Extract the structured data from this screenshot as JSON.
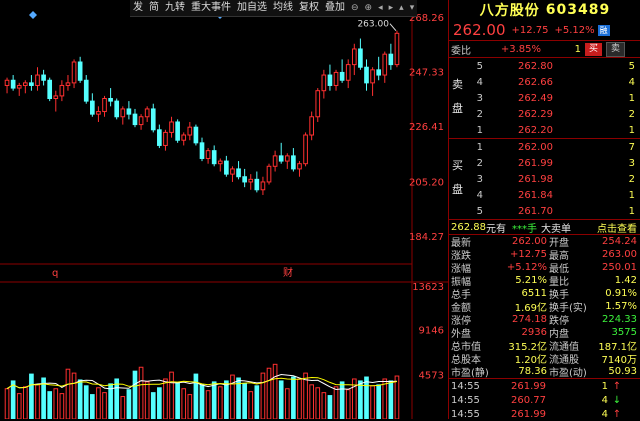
{
  "toolbar": {
    "items": [
      "发",
      "简",
      "九转",
      "重大事件",
      "加自选",
      "均线",
      "复权",
      "叠加"
    ],
    "controls": [
      "⊖",
      "⊕",
      "◂",
      "▸",
      "▴",
      "▾"
    ]
  },
  "chart": {
    "y_labels": [
      "268.26",
      "247.33",
      "226.41",
      "205.20",
      "184.27"
    ],
    "high_label": "263.00",
    "markers": [
      "q",
      "财"
    ],
    "vol_labels": [
      "13623",
      "9146",
      "4573"
    ],
    "colors": {
      "up": "#ff3030",
      "down": "#55ffff",
      "ma1": "#ffffff",
      "ma2": "#ffff00",
      "grid": "#8b0000"
    }
  },
  "chart_data": {
    "type": "candlestick",
    "price_candles": [
      [
        242,
        245,
        239,
        244
      ],
      [
        244,
        246,
        240,
        241
      ],
      [
        241,
        243,
        238,
        242
      ],
      [
        242,
        244,
        239,
        243
      ],
      [
        243,
        246,
        240,
        242
      ],
      [
        242,
        249,
        240,
        246
      ],
      [
        246,
        248,
        242,
        244
      ],
      [
        244,
        245,
        236,
        237
      ],
      [
        237,
        240,
        232,
        238
      ],
      [
        238,
        244,
        236,
        242
      ],
      [
        242,
        246,
        240,
        243
      ],
      [
        243,
        252,
        241,
        251
      ],
      [
        251,
        253,
        243,
        244
      ],
      [
        244,
        246,
        235,
        236
      ],
      [
        236,
        239,
        230,
        231
      ],
      [
        231,
        234,
        228,
        232
      ],
      [
        232,
        238,
        230,
        237
      ],
      [
        237,
        241,
        234,
        236
      ],
      [
        236,
        237,
        229,
        230
      ],
      [
        230,
        234,
        227,
        233
      ],
      [
        233,
        236,
        229,
        231
      ],
      [
        231,
        233,
        226,
        227
      ],
      [
        227,
        231,
        225,
        230
      ],
      [
        230,
        234,
        228,
        233
      ],
      [
        233,
        235,
        224,
        225
      ],
      [
        225,
        227,
        218,
        219
      ],
      [
        219,
        225,
        217,
        224
      ],
      [
        224,
        230,
        222,
        228
      ],
      [
        228,
        229,
        220,
        221
      ],
      [
        221,
        224,
        219,
        223
      ],
      [
        223,
        228,
        221,
        226
      ],
      [
        226,
        227,
        219,
        220
      ],
      [
        220,
        222,
        213,
        214
      ],
      [
        214,
        218,
        212,
        217
      ],
      [
        217,
        219,
        211,
        212
      ],
      [
        212,
        214,
        209,
        213
      ],
      [
        213,
        215,
        207,
        208
      ],
      [
        208,
        211,
        205,
        210
      ],
      [
        210,
        213,
        206,
        207
      ],
      [
        207,
        210,
        203,
        205
      ],
      [
        205,
        208,
        202,
        206
      ],
      [
        206,
        209,
        201,
        202
      ],
      [
        202,
        207,
        200,
        205
      ],
      [
        205,
        212,
        204,
        211
      ],
      [
        211,
        217,
        209,
        215
      ],
      [
        215,
        220,
        212,
        213
      ],
      [
        213,
        216,
        210,
        215
      ],
      [
        215,
        218,
        209,
        210
      ],
      [
        210,
        213,
        207,
        212
      ],
      [
        212,
        224,
        211,
        223
      ],
      [
        223,
        232,
        221,
        230
      ],
      [
        230,
        241,
        228,
        240
      ],
      [
        240,
        248,
        237,
        246
      ],
      [
        246,
        250,
        240,
        242
      ],
      [
        242,
        248,
        240,
        247
      ],
      [
        247,
        252,
        243,
        244
      ],
      [
        244,
        252,
        241,
        250
      ],
      [
        250,
        258,
        246,
        256
      ],
      [
        256,
        260,
        248,
        249
      ],
      [
        249,
        252,
        240,
        243
      ],
      [
        243,
        249,
        238,
        248
      ],
      [
        248,
        253,
        244,
        246
      ],
      [
        246,
        255,
        243,
        254
      ],
      [
        254,
        258,
        248,
        250
      ],
      [
        250,
        263,
        249,
        262
      ]
    ],
    "volumes": [
      3100,
      3900,
      2600,
      3300,
      4600,
      3500,
      4200,
      2800,
      3100,
      2600,
      5100,
      4700,
      4000,
      3400,
      2500,
      3200,
      2700,
      3600,
      4100,
      2300,
      3000,
      4900,
      5300,
      3800,
      2700,
      3200,
      4100,
      4800,
      3700,
      3100,
      2500,
      4600,
      3500,
      2900,
      3800,
      3300,
      3900,
      4500,
      4200,
      3600,
      2800,
      3400,
      4700,
      5200,
      5600,
      3900,
      3100,
      4300,
      4100,
      4700,
      3500,
      3200,
      2700,
      2400,
      3300,
      3800,
      3000,
      4100,
      3900,
      4300,
      3400,
      3500,
      4100,
      3900,
      4400
    ],
    "y_axis": [
      184.27,
      205.2,
      226.41,
      247.33,
      268.26
    ],
    "vol_axis": [
      4573,
      9146,
      13623
    ]
  },
  "panel": {
    "name": "八方股份",
    "code": "603489",
    "price": "262.00",
    "change": "+12.75",
    "change_pct": "+5.12%",
    "badge": "融",
    "weibi_label": "委比",
    "weibi_val": "+3.85%",
    "weibi_count": "1",
    "buy_label": "买",
    "sell_label": "卖",
    "sell_side": [
      "卖",
      "盘"
    ],
    "buy_side": [
      "买",
      "盘"
    ],
    "asks": [
      {
        "lvl": "5",
        "price": "262.80",
        "vol": "5"
      },
      {
        "lvl": "4",
        "price": "262.66",
        "vol": "4"
      },
      {
        "lvl": "3",
        "price": "262.49",
        "vol": "1"
      },
      {
        "lvl": "2",
        "price": "262.29",
        "vol": "2"
      },
      {
        "lvl": "1",
        "price": "262.20",
        "vol": "1"
      }
    ],
    "bids": [
      {
        "lvl": "1",
        "price": "262.00",
        "vol": "7"
      },
      {
        "lvl": "2",
        "price": "261.99",
        "vol": "3"
      },
      {
        "lvl": "3",
        "price": "261.98",
        "vol": "2"
      },
      {
        "lvl": "4",
        "price": "261.84",
        "vol": "1"
      },
      {
        "lvl": "5",
        "price": "261.70",
        "vol": "1"
      }
    ],
    "tradebar": {
      "price": "262.88",
      "unit": "元有",
      "stars": "***手",
      "big": "大卖单",
      "link": "点击查看"
    },
    "stats": [
      {
        "l1": "最新",
        "v1": "262.00",
        "c1": "red",
        "l2": "开盘",
        "v2": "254.24",
        "c2": "red"
      },
      {
        "l1": "涨跌",
        "v1": "+12.75",
        "c1": "red",
        "l2": "最高",
        "v2": "263.00",
        "c2": "red"
      },
      {
        "l1": "涨幅",
        "v1": "+5.12%",
        "c1": "red",
        "l2": "最低",
        "v2": "250.01",
        "c2": "red"
      },
      {
        "l1": "振幅",
        "v1": "5.21%",
        "c1": "yellow",
        "l2": "量比",
        "v2": "1.42",
        "c2": "yellow"
      },
      {
        "l1": "总手",
        "v1": "6511",
        "c1": "yellow",
        "l2": "换手",
        "v2": "0.91%",
        "c2": "yellow"
      },
      {
        "l1": "金额",
        "v1": "1.69亿",
        "c1": "yellow",
        "l2": "换手(实)",
        "v2": "1.57%",
        "c2": "yellow"
      },
      {
        "l1": "涨停",
        "v1": "274.18",
        "c1": "red",
        "l2": "跌停",
        "v2": "224.33",
        "c2": "green"
      },
      {
        "l1": "外盘",
        "v1": "2936",
        "c1": "red",
        "l2": "内盘",
        "v2": "3575",
        "c2": "green"
      },
      {
        "l1": "总市值",
        "v1": "315.2亿",
        "c1": "yellow",
        "l2": "流通值",
        "v2": "187.1亿",
        "c2": "yellow"
      },
      {
        "l1": "总股本",
        "v1": "1.20亿",
        "c1": "yellow",
        "l2": "流通股",
        "v2": "7140万",
        "c2": "yellow"
      },
      {
        "l1": "市盈(静)",
        "v1": "78.36",
        "c1": "yellow",
        "l2": "市盈(动)",
        "v2": "50.93",
        "c2": "yellow"
      }
    ],
    "ticks": [
      {
        "time": "14:55",
        "price": "261.99",
        "vol": "1",
        "dir": "↑",
        "pc": "red",
        "dc": "red"
      },
      {
        "time": "14:55",
        "price": "260.77",
        "vol": "4",
        "dir": "↓",
        "pc": "red",
        "dc": "green"
      },
      {
        "time": "14:55",
        "price": "261.99",
        "vol": "4",
        "dir": "↑",
        "pc": "red",
        "dc": "red"
      }
    ]
  }
}
